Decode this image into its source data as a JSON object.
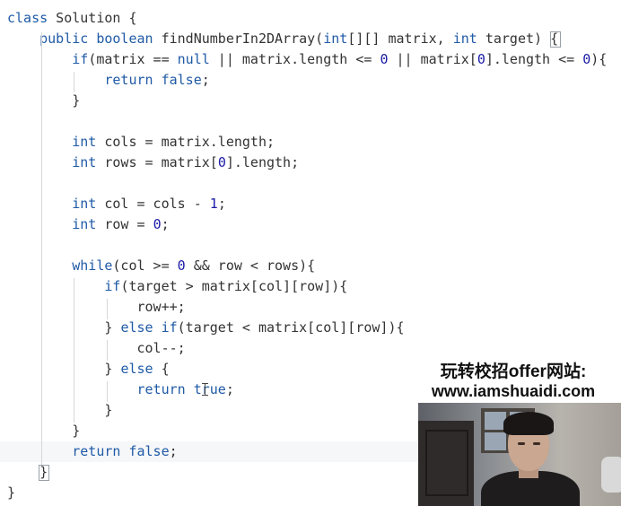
{
  "editor": {
    "lines": [
      [
        {
          "t": "class",
          "c": "keyword"
        },
        {
          "t": " Solution ",
          "c": "plain"
        },
        {
          "t": "{",
          "c": "plain"
        }
      ],
      [
        {
          "t": "    ",
          "c": "plain"
        },
        {
          "t": "public boolean",
          "c": "keyword"
        },
        {
          "t": " findNumberIn2DArray(",
          "c": "plain"
        },
        {
          "t": "int",
          "c": "keyword"
        },
        {
          "t": "[][] matrix, ",
          "c": "plain"
        },
        {
          "t": "int",
          "c": "keyword"
        },
        {
          "t": " target) {",
          "c": "plain"
        }
      ],
      [
        {
          "t": "        ",
          "c": "plain"
        },
        {
          "t": "if",
          "c": "keyword"
        },
        {
          "t": "(matrix == ",
          "c": "plain"
        },
        {
          "t": "null",
          "c": "keyword"
        },
        {
          "t": " || matrix.length <= ",
          "c": "plain"
        },
        {
          "t": "0",
          "c": "number"
        },
        {
          "t": " || matrix[",
          "c": "plain"
        },
        {
          "t": "0",
          "c": "number"
        },
        {
          "t": "].length <= ",
          "c": "plain"
        },
        {
          "t": "0",
          "c": "number"
        },
        {
          "t": "){",
          "c": "plain"
        }
      ],
      [
        {
          "t": "            ",
          "c": "plain"
        },
        {
          "t": "return false",
          "c": "keyword"
        },
        {
          "t": ";",
          "c": "plain"
        }
      ],
      [
        {
          "t": "        }",
          "c": "plain"
        }
      ],
      [],
      [
        {
          "t": "        ",
          "c": "plain"
        },
        {
          "t": "int",
          "c": "keyword"
        },
        {
          "t": " cols = matrix.length;",
          "c": "plain"
        }
      ],
      [
        {
          "t": "        ",
          "c": "plain"
        },
        {
          "t": "int",
          "c": "keyword"
        },
        {
          "t": " rows = matrix[",
          "c": "plain"
        },
        {
          "t": "0",
          "c": "number"
        },
        {
          "t": "].length;",
          "c": "plain"
        }
      ],
      [],
      [
        {
          "t": "        ",
          "c": "plain"
        },
        {
          "t": "int",
          "c": "keyword"
        },
        {
          "t": " col = cols - ",
          "c": "plain"
        },
        {
          "t": "1",
          "c": "number"
        },
        {
          "t": ";",
          "c": "plain"
        }
      ],
      [
        {
          "t": "        ",
          "c": "plain"
        },
        {
          "t": "int",
          "c": "keyword"
        },
        {
          "t": " row = ",
          "c": "plain"
        },
        {
          "t": "0",
          "c": "number"
        },
        {
          "t": ";",
          "c": "plain"
        }
      ],
      [],
      [
        {
          "t": "        ",
          "c": "plain"
        },
        {
          "t": "while",
          "c": "keyword"
        },
        {
          "t": "(col >= ",
          "c": "plain"
        },
        {
          "t": "0",
          "c": "number"
        },
        {
          "t": " && row < rows){",
          "c": "plain"
        }
      ],
      [
        {
          "t": "            ",
          "c": "plain"
        },
        {
          "t": "if",
          "c": "keyword"
        },
        {
          "t": "(target > matrix[col][row]){",
          "c": "plain"
        }
      ],
      [
        {
          "t": "                row++;",
          "c": "plain"
        }
      ],
      [
        {
          "t": "            } ",
          "c": "plain"
        },
        {
          "t": "else if",
          "c": "keyword"
        },
        {
          "t": "(target < matrix[col][row]){",
          "c": "plain"
        }
      ],
      [
        {
          "t": "                col--;",
          "c": "plain"
        }
      ],
      [
        {
          "t": "            } ",
          "c": "plain"
        },
        {
          "t": "else",
          "c": "keyword"
        },
        {
          "t": " {",
          "c": "plain"
        }
      ],
      [
        {
          "t": "                ",
          "c": "plain"
        },
        {
          "t": "return true",
          "c": "keyword"
        },
        {
          "t": ";",
          "c": "plain"
        }
      ],
      [
        {
          "t": "            }",
          "c": "plain"
        }
      ],
      [
        {
          "t": "        }",
          "c": "plain"
        }
      ],
      [
        {
          "t": "        ",
          "c": "plain"
        },
        {
          "t": "return false",
          "c": "keyword"
        },
        {
          "t": ";",
          "c": "plain"
        }
      ],
      [
        {
          "t": "    }",
          "c": "plain"
        }
      ],
      [
        {
          "t": "}",
          "c": "plain"
        }
      ]
    ],
    "cursor_line": 21
  },
  "overlay": {
    "line1": "玩转校招offer网站:",
    "line2": "www.iamshuaidi.com"
  },
  "colors": {
    "keyword": "#1f5aa6",
    "plain": "#333333",
    "number": "#1a1aa6",
    "background": "#ffffff"
  }
}
